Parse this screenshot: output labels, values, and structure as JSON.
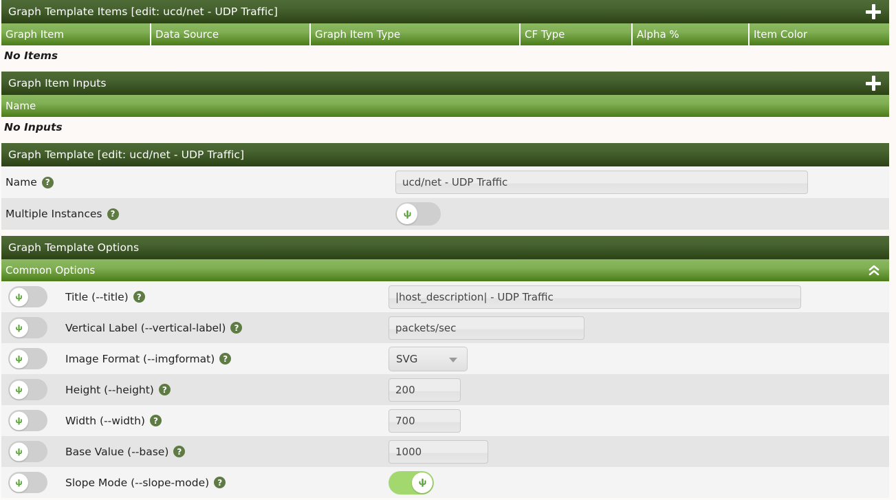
{
  "sections": {
    "graph_template_items": {
      "title": "Graph Template Items [edit: ucd/net - UDP Traffic]",
      "add_icon": "plus-icon",
      "columns": [
        "Graph Item",
        "Data Source",
        "Graph Item Type",
        "CF Type",
        "Alpha %",
        "Item Color"
      ],
      "empty_text": "No Items"
    },
    "graph_item_inputs": {
      "title": "Graph Item Inputs",
      "add_icon": "plus-icon",
      "columns": [
        "Name"
      ],
      "empty_text": "No Inputs"
    },
    "graph_template": {
      "title": "Graph Template [edit: ucd/net - UDP Traffic]",
      "fields": [
        {
          "label": "Name",
          "help_icon": "help-icon",
          "type": "text",
          "value": "ucd/net - UDP Traffic",
          "name": "template-name-input"
        },
        {
          "label": "Multiple Instances",
          "help_icon": "help-icon",
          "type": "toggle",
          "state": "off",
          "name": "multiple-instances-toggle"
        }
      ]
    },
    "graph_template_options": {
      "title": "Graph Template Options",
      "subsection": {
        "title": "Common Options",
        "collapse_icon": "double-chevron-up-icon"
      },
      "options": [
        {
          "toggle_state": "off",
          "label": "Title (--title)",
          "help_icon": "help-icon",
          "control": "text",
          "value": "|host_description| - UDP Traffic",
          "name": "title-input",
          "width_class": "w-600"
        },
        {
          "toggle_state": "off",
          "label": "Vertical Label (--vertical-label)",
          "help_icon": "help-icon",
          "control": "text",
          "value": "packets/sec",
          "name": "vertical-label-input",
          "width_class": "w-285"
        },
        {
          "toggle_state": "off",
          "label": "Image Format (--imgformat)",
          "help_icon": "help-icon",
          "control": "select",
          "value": "SVG",
          "name": "image-format-select",
          "width_class": ""
        },
        {
          "toggle_state": "off",
          "label": "Height (--height)",
          "help_icon": "help-icon",
          "control": "text",
          "value": "200",
          "name": "height-input",
          "width_class": "w-105"
        },
        {
          "toggle_state": "off",
          "label": "Width (--width)",
          "help_icon": "help-icon",
          "control": "text",
          "value": "700",
          "name": "width-input",
          "width_class": "w-105"
        },
        {
          "toggle_state": "off",
          "label": "Base Value (--base)",
          "help_icon": "help-icon",
          "control": "text",
          "value": "1000",
          "name": "base-value-input",
          "width_class": "w-145"
        },
        {
          "toggle_state": "off",
          "label": "Slope Mode (--slope-mode)",
          "help_icon": "help-icon",
          "control": "toggle",
          "value": "on",
          "name": "slope-mode-toggle",
          "width_class": ""
        }
      ]
    }
  },
  "colors": {
    "header_dark_top": "#4e6b36",
    "header_dark_bottom": "#2c4216",
    "header_green_top": "#8cb962",
    "header_green_bottom": "#4b7c18",
    "page_background": "#fdf9f7",
    "row_light": "#f4f4f4",
    "row_dark": "#e5e5e5",
    "toggle_on": "#a3d86f",
    "toggle_off": "#cfcfcf",
    "help_badge": "#5d7b42",
    "cactus_green": "#4f9b2f"
  },
  "icons": {
    "help": "?",
    "cactus": "cactus-icon"
  }
}
